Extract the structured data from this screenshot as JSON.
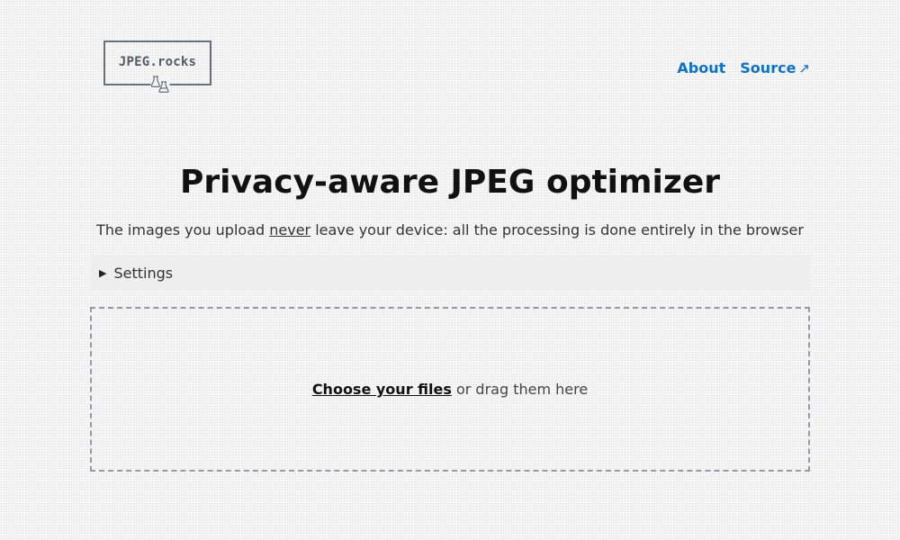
{
  "header": {
    "logo_text": "JPEG.rocks",
    "logo_icon": "lab-flask-icon",
    "nav": {
      "about_label": "About",
      "source_label": "Source",
      "source_ext_icon": "↗"
    }
  },
  "main": {
    "title": "Privacy-aware JPEG optimizer",
    "subtitle_before": "The images you upload ",
    "subtitle_emphasis": "never",
    "subtitle_after": " leave your device: all the processing is done entirely in the browser",
    "settings_label": "Settings",
    "dropzone": {
      "choose_label": "Choose your files",
      "drag_text": " or drag them here"
    }
  },
  "colors": {
    "link": "#0d72c6",
    "logo_border": "#6b6e7a",
    "dropzone_border": "#9a98a2"
  }
}
